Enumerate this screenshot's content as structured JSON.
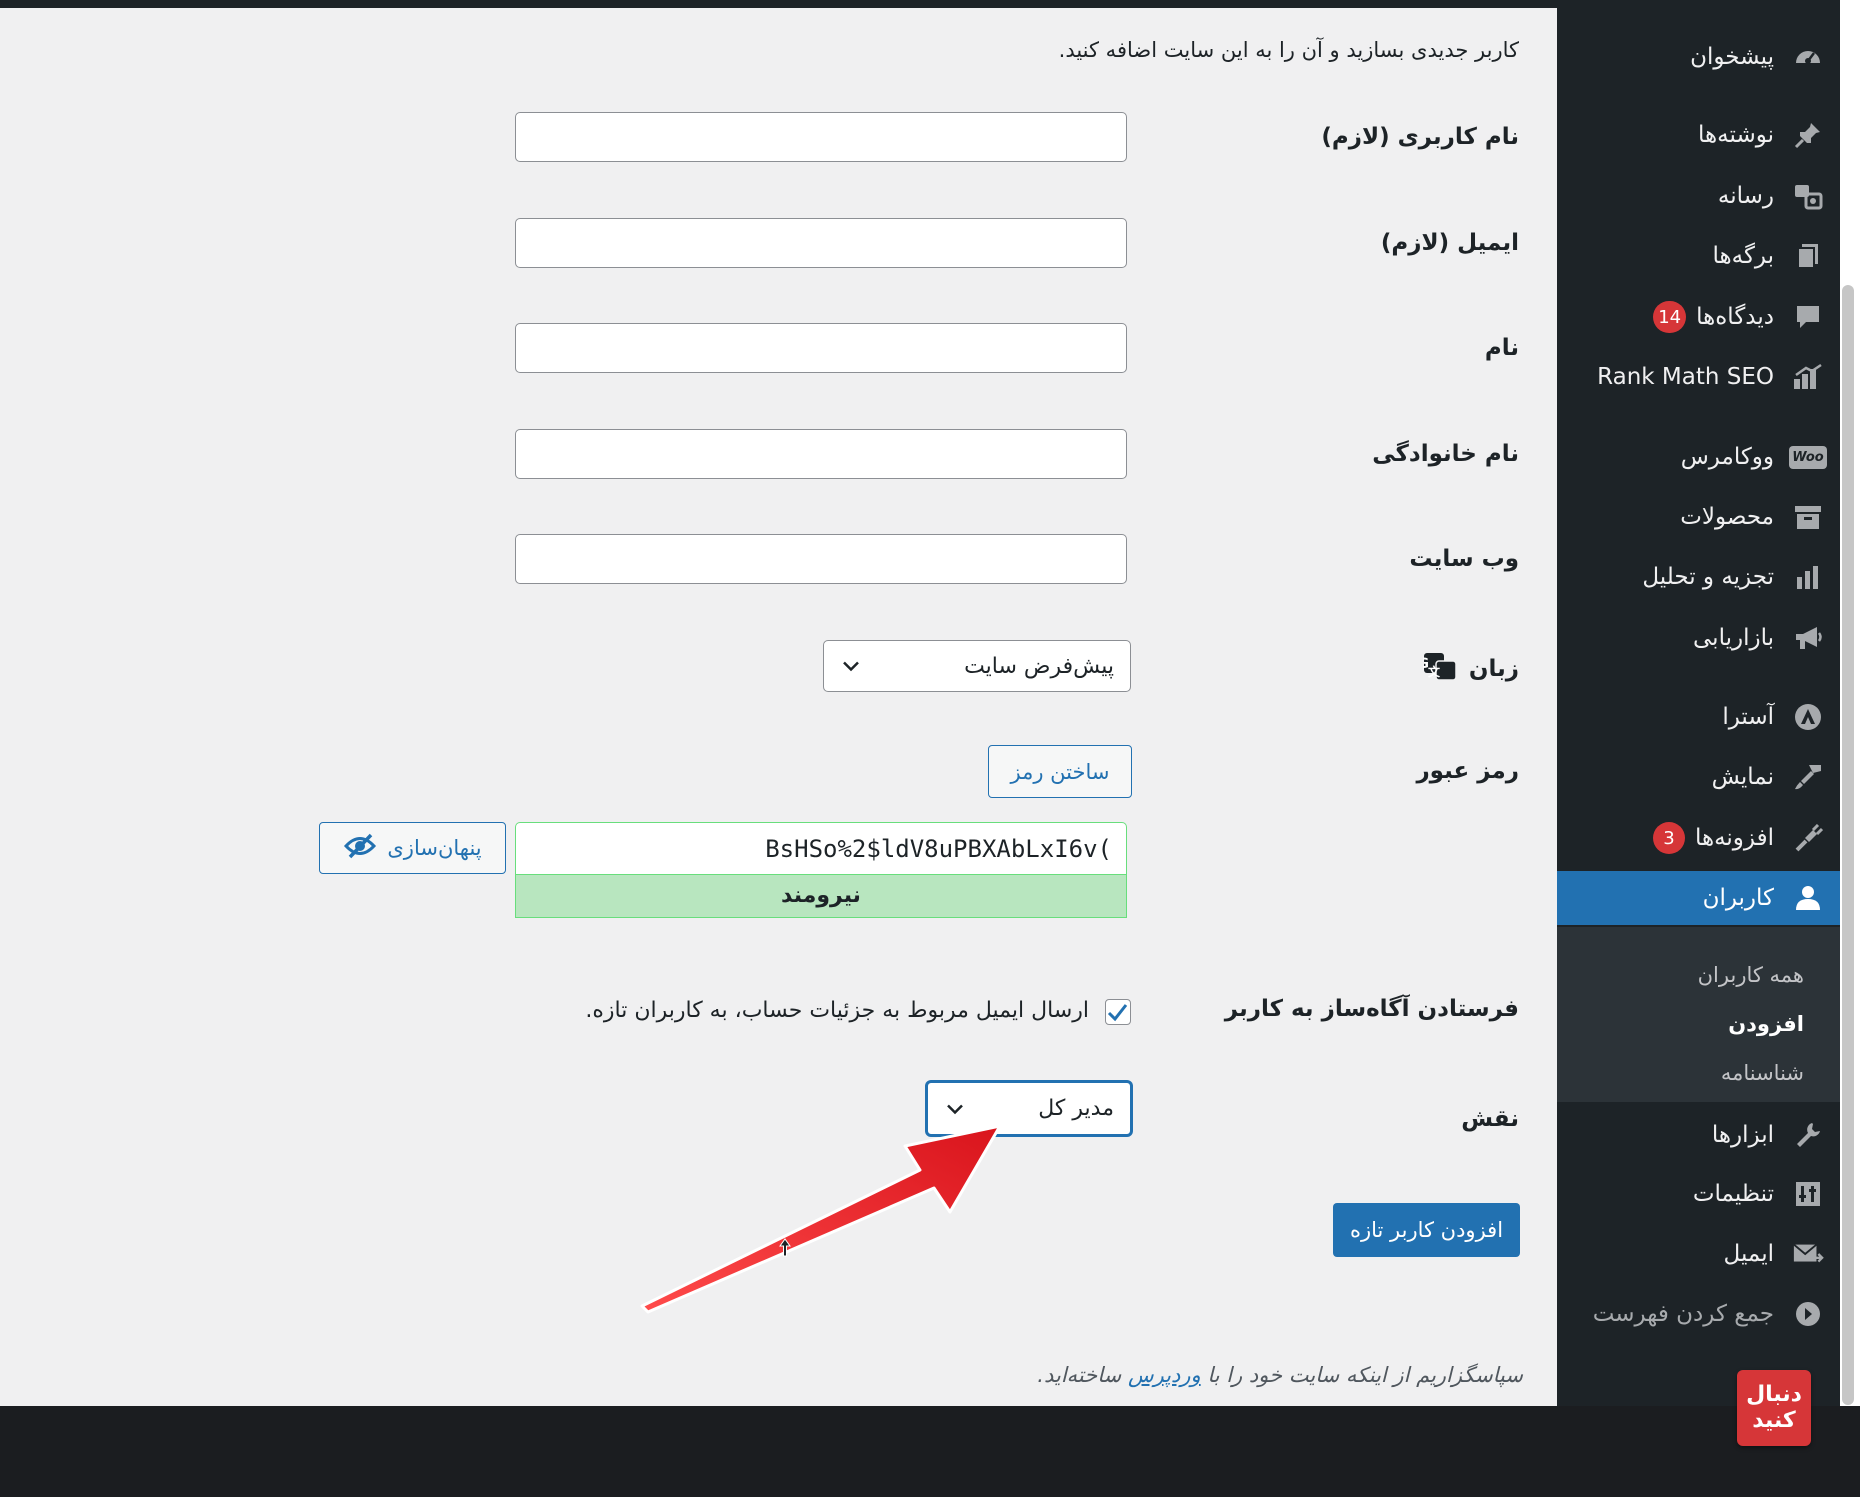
{
  "form": {
    "intro": "کاربر جدیدی بسازید و آن را به این سایت اضافه کنید.",
    "labels": {
      "username": "نام کاربری (لازم)",
      "email": "ایمیل (لازم)",
      "first_name": "نام",
      "last_name": "نام خانوادگی",
      "website": "وب سایت",
      "language": "زبان",
      "password": "رمز عبور",
      "notify": "فرستادن آگاه‌ساز به کاربر",
      "role": "نقش"
    },
    "values": {
      "username": "",
      "email": "",
      "first_name": "",
      "last_name": "",
      "website": ""
    },
    "language_selected": "پیش‌فرض سایت",
    "generate_password_label": "ساختن رمز",
    "password_value": "BsHSo%2$ldV8uPBXAbLxI6v(",
    "hide_label": "پنهان‌سازی",
    "strength_label": "نیرومند",
    "notify_checked": true,
    "notify_text": "ارسال ایمیل مربوط به جزئیات حساب، به کاربران تازه.",
    "role_selected": "مدیر کل",
    "submit_label": "افزودن کاربر تازه"
  },
  "footer": {
    "prefix": "سپاسگزاریم از اینکه سایت خود را با",
    "link": "وردپرس",
    "suffix": "ساخته‌اید."
  },
  "sidebar": {
    "items": [
      {
        "label": "پیشخوان",
        "icon": "dashboard-icon"
      },
      {
        "label": "نوشته‌ها",
        "icon": "pin-icon"
      },
      {
        "label": "رسانه",
        "icon": "media-icon"
      },
      {
        "label": "برگه‌ها",
        "icon": "pages-icon"
      },
      {
        "label": "دیدگاه‌ها",
        "icon": "comments-icon",
        "badge": "14"
      },
      {
        "label": "Rank Math SEO",
        "icon": "rank-math-icon"
      },
      {
        "label": "ووکامرس",
        "icon": "woo-icon",
        "icon_text": "Woo"
      },
      {
        "label": "محصولات",
        "icon": "archive-icon"
      },
      {
        "label": "تجزیه و تحلیل",
        "icon": "bar-chart-icon"
      },
      {
        "label": "بازاریابی",
        "icon": "megaphone-icon"
      },
      {
        "label": "آسترا",
        "icon": "astra-icon"
      },
      {
        "label": "نمایش",
        "icon": "brush-icon"
      },
      {
        "label": "افزونه‌ها",
        "icon": "plugin-icon",
        "badge": "3"
      },
      {
        "label": "کاربران",
        "icon": "user-icon",
        "active": true
      },
      {
        "label": "ابزارها",
        "icon": "wrench-icon"
      },
      {
        "label": "تنظیمات",
        "icon": "settings-icon"
      },
      {
        "label": "ایمیل",
        "icon": "mail-icon"
      },
      {
        "label": "جمع کردن فهرست",
        "icon": "collapse-icon"
      }
    ],
    "submenu": [
      {
        "label": "همه کاربران"
      },
      {
        "label": "افزودن",
        "current": true
      },
      {
        "label": "شناسنامه"
      }
    ]
  },
  "follow_badge": {
    "line1": "دنبال",
    "line2": "کنید"
  },
  "colors": {
    "accent": "#2271b1",
    "sidebar_bg": "#1d2327",
    "badge": "#d63638",
    "strength_bg": "#b8e6bf",
    "arrow": "#e8202a"
  }
}
